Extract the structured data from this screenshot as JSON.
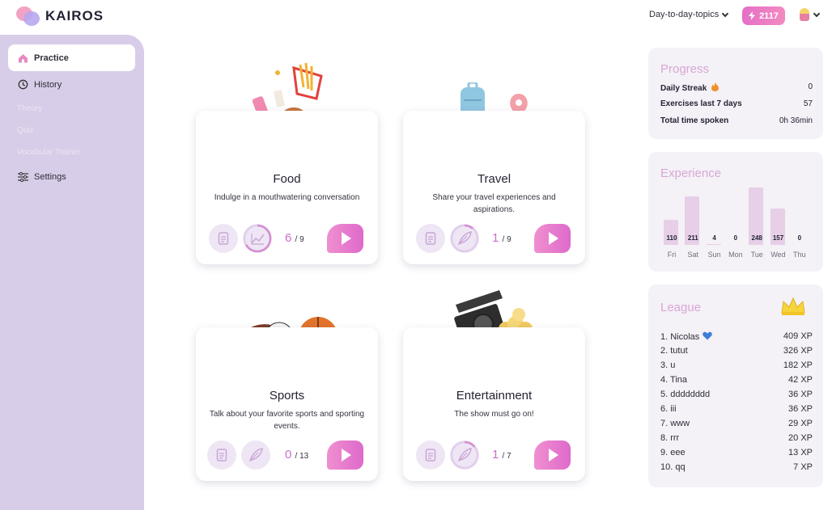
{
  "app": {
    "logo_text": "KAIROS"
  },
  "header": {
    "topic_select": "Day-to-day-topics",
    "gems": "2117"
  },
  "sidebar": {
    "items": [
      {
        "label": "Practice",
        "icon": "home-icon",
        "active": true
      },
      {
        "label": "History",
        "icon": "history-icon"
      },
      {
        "label": "Theory",
        "faded": true
      },
      {
        "label": "Quiz",
        "faded": true
      },
      {
        "label": "Vocabular Trainer",
        "faded": true
      },
      {
        "label": "Settings",
        "icon": "sliders-icon"
      }
    ]
  },
  "cards": [
    {
      "title": "Food",
      "desc": "Indulge in a mouthwatering conversation",
      "done": "6",
      "total": "/ 9",
      "progress": 0.67
    },
    {
      "title": "Travel",
      "desc": "Share your travel experiences and aspirations.",
      "done": "1",
      "total": "/ 9",
      "progress": 0.11
    },
    {
      "title": "Sports",
      "desc": "Talk about your favorite sports and sporting events.",
      "done": "0",
      "total": "/ 13",
      "progress": 0
    },
    {
      "title": "Entertainment",
      "desc": "The show must go on!",
      "done": "1",
      "total": "/ 7",
      "progress": 0.14
    }
  ],
  "progress_panel": {
    "title": "Progress",
    "rows": [
      {
        "label": "Daily Streak",
        "value": "0"
      },
      {
        "label": "Exercises last 7 days",
        "value": "57"
      },
      {
        "label": "Total time spoken",
        "value": "0h 36min"
      }
    ]
  },
  "experience_panel": {
    "title": "Experience"
  },
  "chart_data": {
    "type": "bar",
    "categories": [
      "Fri",
      "Sat",
      "Sun",
      "Mon",
      "Tue",
      "Wed",
      "Thu"
    ],
    "values": [
      110,
      211,
      4,
      0,
      248,
      157,
      0
    ],
    "value_labels": [
      "110",
      "211",
      "4",
      "0",
      "248",
      "157",
      "0"
    ],
    "title": "Experience",
    "ylim": [
      0,
      260
    ]
  },
  "league_panel": {
    "title": "League",
    "rows": [
      {
        "name": "1. Nicolas",
        "xp": "409 XP",
        "heart": true
      },
      {
        "name": "2. tutut",
        "xp": "326 XP"
      },
      {
        "name": "3. u",
        "xp": "182 XP"
      },
      {
        "name": "4. Tina",
        "xp": "42 XP"
      },
      {
        "name": "5. dddddddd",
        "xp": "36 XP"
      },
      {
        "name": "6. iii",
        "xp": "36 XP"
      },
      {
        "name": "7. www",
        "xp": "29 XP"
      },
      {
        "name": "8. rrr",
        "xp": "20 XP"
      },
      {
        "name": "9. eee",
        "xp": "13 XP"
      },
      {
        "name": "10. qq",
        "xp": "7 XP"
      }
    ]
  },
  "colors": {
    "accent": "#e56fc8",
    "sidebar": "#d8cde8",
    "panel_title": "#d9a7d6",
    "bar": "#e6cfe7"
  }
}
